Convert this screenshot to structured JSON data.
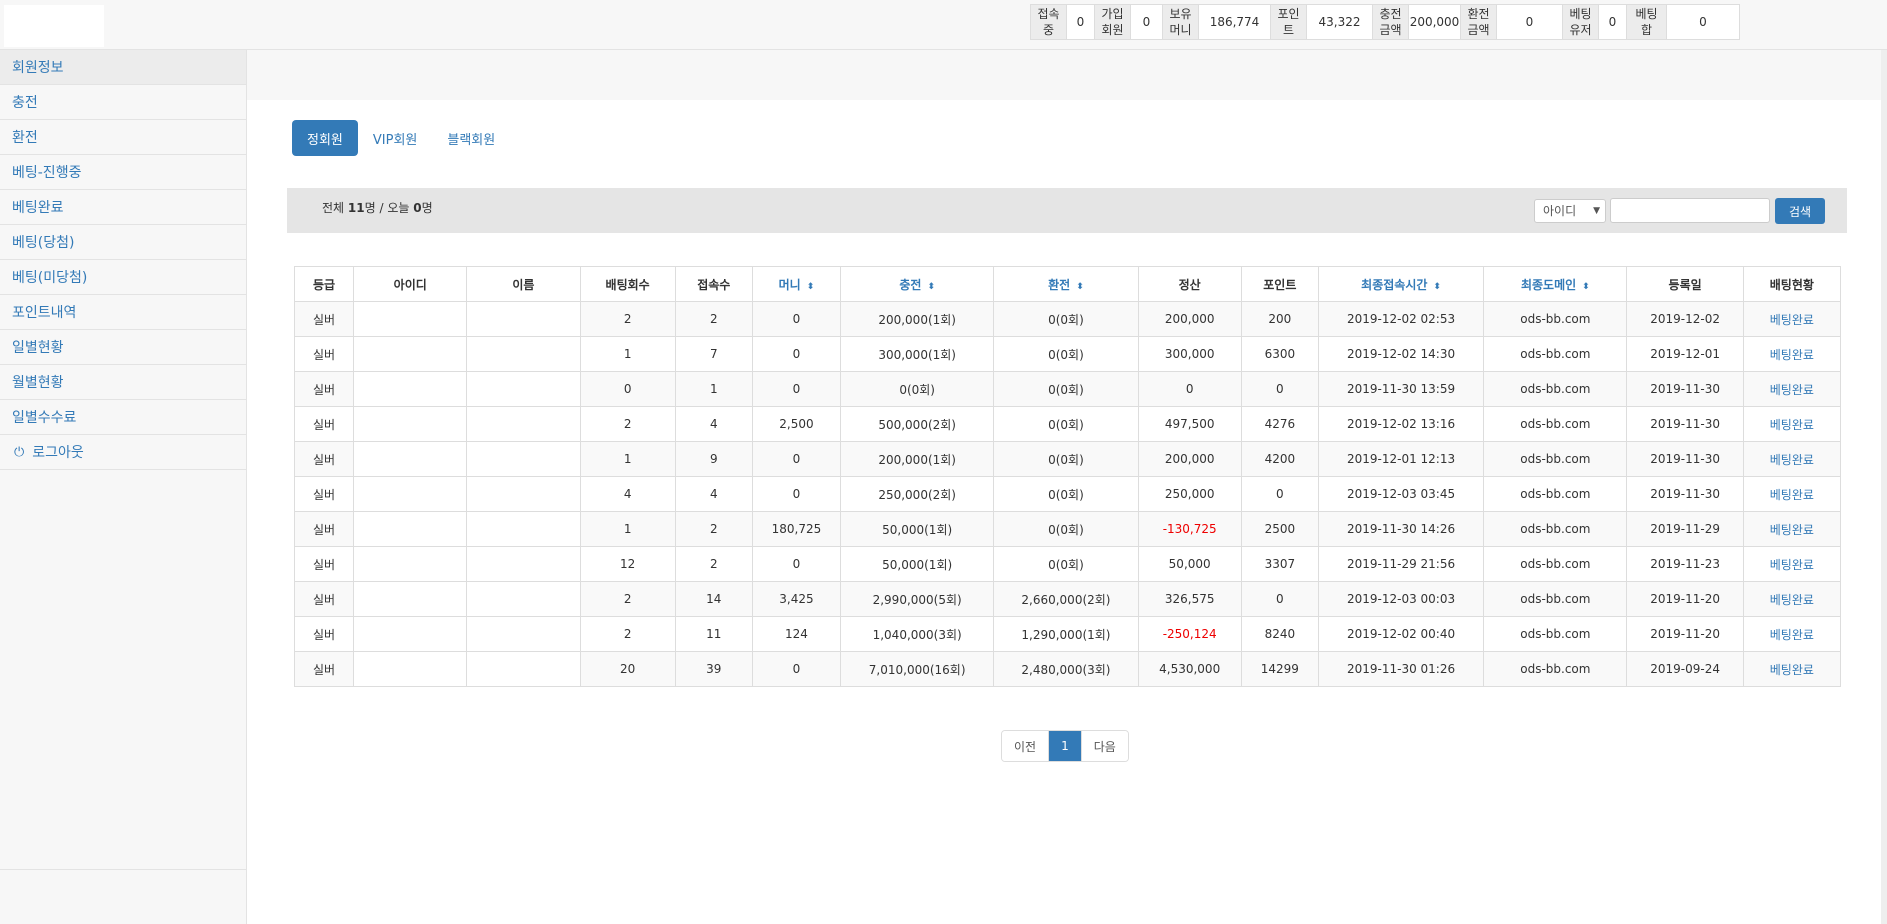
{
  "stats": [
    {
      "label": "접속중",
      "value": "0"
    },
    {
      "label": "가입\n회원",
      "value": "0"
    },
    {
      "label": "보유\n머니",
      "value": "186,774"
    },
    {
      "label": "포인트",
      "value": "43,322"
    },
    {
      "label": "충전\n금액",
      "value": "200,000"
    },
    {
      "label": "환전\n금액",
      "value": "0"
    },
    {
      "label": "베팅\n유저",
      "value": "0"
    },
    {
      "label": "베팅합",
      "value": "0"
    }
  ],
  "sidebar": {
    "items": [
      {
        "label": "회원정보"
      },
      {
        "label": "충전"
      },
      {
        "label": "환전"
      },
      {
        "label": "베팅-진행중"
      },
      {
        "label": "베팅완료"
      },
      {
        "label": "베팅(당첨)"
      },
      {
        "label": "베팅(미당첨)"
      },
      {
        "label": "포인트내역"
      },
      {
        "label": "일별현황"
      },
      {
        "label": "월별현황"
      },
      {
        "label": "일별수수료"
      },
      {
        "label": "로그아웃"
      }
    ],
    "logout_icon": "power-icon"
  },
  "tabs": [
    {
      "label": "정회원"
    },
    {
      "label": "VIP회원"
    },
    {
      "label": "블랙회원"
    }
  ],
  "search": {
    "total_prefix": "전체",
    "total_count": "11",
    "total_mid": "명 / 오늘",
    "today_count": "0",
    "total_suffix": "명",
    "select_value": "아이디",
    "button_label": "검색"
  },
  "table": {
    "headers": [
      "등급",
      "아이디",
      "이름",
      "배팅회수",
      "접속수",
      "머니",
      "충전",
      "환전",
      "정산",
      "포인트",
      "최종접속시간",
      "최종도메인",
      "등록일",
      "배팅현황"
    ],
    "rows": [
      [
        "실버",
        "",
        "",
        "2",
        "2",
        "0",
        "200,000(1회)",
        "0(0회)",
        "200,000",
        "200",
        "2019-12-02 02:53",
        "ods-bb.com",
        "2019-12-02",
        "베팅완료"
      ],
      [
        "실버",
        "",
        "",
        "1",
        "7",
        "0",
        "300,000(1회)",
        "0(0회)",
        "300,000",
        "6300",
        "2019-12-02 14:30",
        "ods-bb.com",
        "2019-12-01",
        "베팅완료"
      ],
      [
        "실버",
        "",
        "",
        "0",
        "1",
        "0",
        "0(0회)",
        "0(0회)",
        "0",
        "0",
        "2019-11-30 13:59",
        "ods-bb.com",
        "2019-11-30",
        "베팅완료"
      ],
      [
        "실버",
        "",
        "",
        "2",
        "4",
        "2,500",
        "500,000(2회)",
        "0(0회)",
        "497,500",
        "4276",
        "2019-12-02 13:16",
        "ods-bb.com",
        "2019-11-30",
        "베팅완료"
      ],
      [
        "실버",
        "",
        "",
        "1",
        "9",
        "0",
        "200,000(1회)",
        "0(0회)",
        "200,000",
        "4200",
        "2019-12-01 12:13",
        "ods-bb.com",
        "2019-11-30",
        "베팅완료"
      ],
      [
        "실버",
        "",
        "",
        "4",
        "4",
        "0",
        "250,000(2회)",
        "0(0회)",
        "250,000",
        "0",
        "2019-12-03 03:45",
        "ods-bb.com",
        "2019-11-30",
        "베팅완료"
      ],
      [
        "실버",
        "",
        "",
        "1",
        "2",
        "180,725",
        "50,000(1회)",
        "0(0회)",
        "-130,725",
        "2500",
        "2019-11-30 14:26",
        "ods-bb.com",
        "2019-11-29",
        "베팅완료"
      ],
      [
        "실버",
        "",
        "",
        "12",
        "2",
        "0",
        "50,000(1회)",
        "0(0회)",
        "50,000",
        "3307",
        "2019-11-29 21:56",
        "ods-bb.com",
        "2019-11-23",
        "베팅완료"
      ],
      [
        "실버",
        "",
        "",
        "2",
        "14",
        "3,425",
        "2,990,000(5회)",
        "2,660,000(2회)",
        "326,575",
        "0",
        "2019-12-03 00:03",
        "ods-bb.com",
        "2019-11-20",
        "베팅완료"
      ],
      [
        "실버",
        "",
        "",
        "2",
        "11",
        "124",
        "1,040,000(3회)",
        "1,290,000(1회)",
        "-250,124",
        "8240",
        "2019-12-02 00:40",
        "ods-bb.com",
        "2019-11-20",
        "베팅완료"
      ],
      [
        "실버",
        "",
        "",
        "20",
        "39",
        "0",
        "7,010,000(16회)",
        "2,480,000(3회)",
        "4,530,000",
        "14299",
        "2019-11-30 01:26",
        "ods-bb.com",
        "2019-09-24",
        "베팅완료"
      ]
    ]
  },
  "pager": {
    "prev": "이전",
    "current": "1",
    "next": "다음"
  },
  "colors": {
    "accent": "#337ab7",
    "negative": "#ee0000"
  }
}
